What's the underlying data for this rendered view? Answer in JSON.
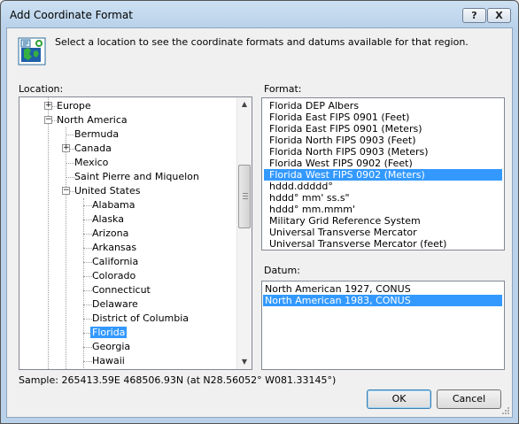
{
  "window": {
    "title": "Add Coordinate Format",
    "help_label": "?",
    "close_label": "X"
  },
  "intro_text": "Select a location to see the coordinate formats and datums available for that region.",
  "location_label": "Location:",
  "format_label": "Format:",
  "datum_label": "Datum:",
  "tree": {
    "items": [
      {
        "label": "Europe",
        "level": 0,
        "expander": "+"
      },
      {
        "label": "North America",
        "level": 0,
        "expander": "−"
      },
      {
        "label": "Bermuda",
        "level": 1,
        "expander": ""
      },
      {
        "label": "Canada",
        "level": 1,
        "expander": "+"
      },
      {
        "label": "Mexico",
        "level": 1,
        "expander": ""
      },
      {
        "label": "Saint Pierre and Miquelon",
        "level": 1,
        "expander": ""
      },
      {
        "label": "United States",
        "level": 1,
        "expander": "−"
      },
      {
        "label": "Alabama",
        "level": 2,
        "expander": ""
      },
      {
        "label": "Alaska",
        "level": 2,
        "expander": ""
      },
      {
        "label": "Arizona",
        "level": 2,
        "expander": ""
      },
      {
        "label": "Arkansas",
        "level": 2,
        "expander": ""
      },
      {
        "label": "California",
        "level": 2,
        "expander": ""
      },
      {
        "label": "Colorado",
        "level": 2,
        "expander": ""
      },
      {
        "label": "Connecticut",
        "level": 2,
        "expander": ""
      },
      {
        "label": "Delaware",
        "level": 2,
        "expander": ""
      },
      {
        "label": "District of Columbia",
        "level": 2,
        "expander": ""
      },
      {
        "label": "Florida",
        "level": 2,
        "expander": "",
        "selected": true
      },
      {
        "label": "Georgia",
        "level": 2,
        "expander": ""
      },
      {
        "label": "Hawaii",
        "level": 2,
        "expander": ""
      }
    ]
  },
  "formats": {
    "items": [
      "Florida DEP Albers",
      "Florida East FIPS 0901 (Feet)",
      "Florida East FIPS 0901 (Meters)",
      "Florida North FIPS 0903 (Feet)",
      "Florida North FIPS 0903 (Meters)",
      "Florida West FIPS 0902 (Feet)",
      "Florida West FIPS 0902 (Meters)",
      "hddd.ddddd°",
      "hddd° mm' ss.s\"",
      "hddd° mm.mmm'",
      "Military Grid Reference System",
      "Universal Transverse Mercator",
      "Universal Transverse Mercator (feet)"
    ],
    "selected_index": 6
  },
  "datums": {
    "items": [
      "North American 1927, CONUS",
      "North American 1983, CONUS"
    ],
    "selected_index": 1
  },
  "sample_text": "Sample: 265413.59E  468506.93N (at N28.56052°  W081.33145°)",
  "buttons": {
    "ok": "OK",
    "cancel": "Cancel"
  },
  "colors": {
    "selection": "#3399ff",
    "title_gradient": "#b9d2ea"
  }
}
